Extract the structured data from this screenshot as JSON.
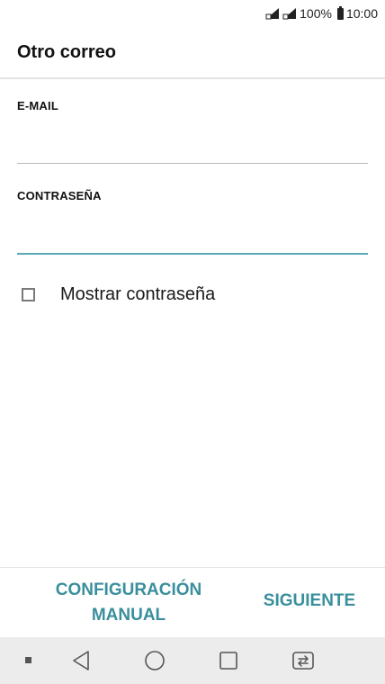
{
  "status_bar": {
    "battery_percent": "100%",
    "time": "10:00",
    "icons": [
      "signal-sim1-icon",
      "signal-sim2-icon",
      "battery-icon"
    ]
  },
  "header": {
    "title": "Otro correo"
  },
  "form": {
    "email": {
      "label": "E-MAIL",
      "value": ""
    },
    "password": {
      "label": "CONTRASEÑA",
      "value": ""
    },
    "show_password": {
      "label": "Mostrar contraseña",
      "checked": false
    }
  },
  "actions": {
    "manual_setup_line1": "CONFIGURACIÓN",
    "manual_setup_line2": "MANUAL",
    "next": "SIGUIENTE",
    "accent_color": "#3a8f9c"
  },
  "nav_bar": {
    "icons": [
      "notification-dot-icon",
      "back-icon",
      "home-icon",
      "recents-icon",
      "dual-window-icon"
    ]
  }
}
